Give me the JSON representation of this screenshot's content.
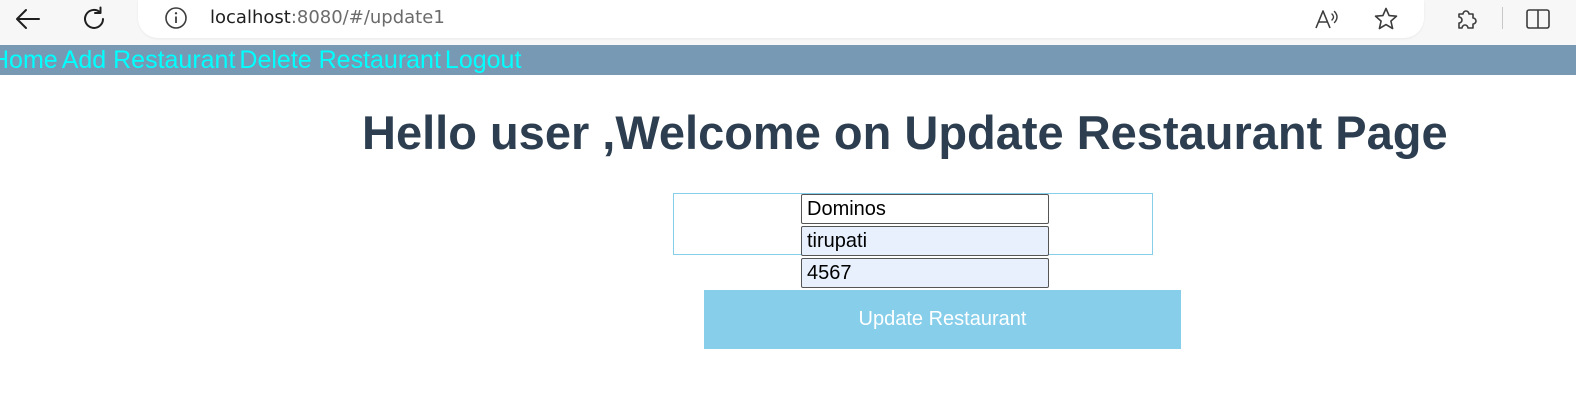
{
  "browser": {
    "url_host": "localhost",
    "url_path": ":8080/#/update1"
  },
  "nav": {
    "items": [
      "Home",
      "Add Restaurant",
      "Delete Restaurant",
      "Logout"
    ]
  },
  "main": {
    "title": "Hello user ,Welcome on Update Restaurant Page",
    "fields": [
      {
        "value": "Dominos"
      },
      {
        "value": "tirupati"
      },
      {
        "value": "4567"
      }
    ],
    "submit_label": "Update Restaurant"
  },
  "colors": {
    "nav_background": "#7899b4",
    "nav_link": "#00ffff",
    "title": "#2c3e50",
    "button": "#87ceeb",
    "autofill_field": "#e8f0fe"
  }
}
